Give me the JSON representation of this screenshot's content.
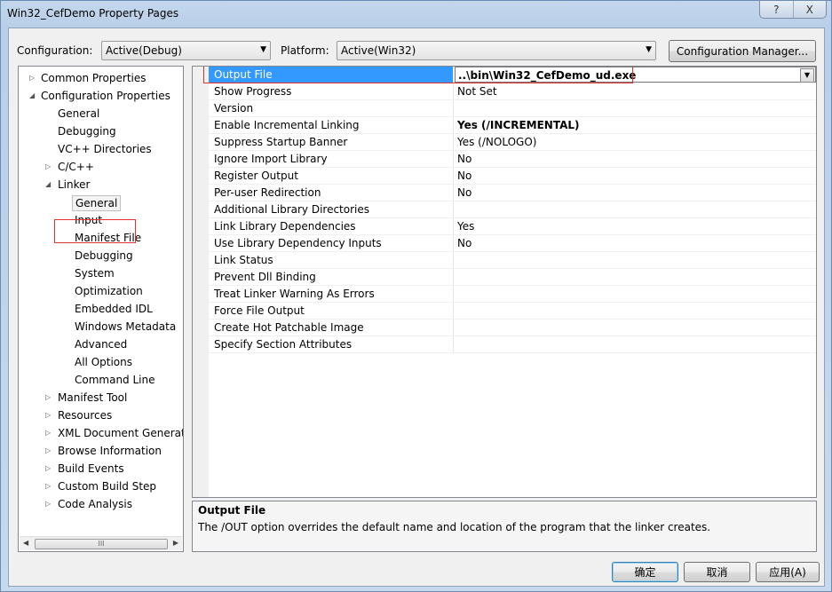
{
  "window": {
    "title": "Win32_CefDemo Property Pages"
  },
  "titlebar_buttons": {
    "help": "?",
    "close": "X"
  },
  "config": {
    "config_label": "Configuration:",
    "config_value": "Active(Debug)",
    "platform_label": "Platform:",
    "platform_value": "Active(Win32)",
    "manager_button": "Configuration Manager..."
  },
  "tree": {
    "items": [
      {
        "label": "Common Properties",
        "expander": "collapsed"
      },
      {
        "label": "Configuration Properties",
        "expander": "expanded"
      },
      {
        "label": "General",
        "expander": "none"
      },
      {
        "label": "Debugging",
        "expander": "none"
      },
      {
        "label": "VC++ Directories",
        "expander": "none"
      },
      {
        "label": "C/C++",
        "expander": "collapsed"
      },
      {
        "label": "Linker",
        "expander": "expanded"
      },
      {
        "label": "General",
        "expander": "none",
        "selected": true
      },
      {
        "label": "Input",
        "expander": "none"
      },
      {
        "label": "Manifest File",
        "expander": "none"
      },
      {
        "label": "Debugging",
        "expander": "none"
      },
      {
        "label": "System",
        "expander": "none"
      },
      {
        "label": "Optimization",
        "expander": "none"
      },
      {
        "label": "Embedded IDL",
        "expander": "none"
      },
      {
        "label": "Windows Metadata",
        "expander": "none"
      },
      {
        "label": "Advanced",
        "expander": "none"
      },
      {
        "label": "All Options",
        "expander": "none"
      },
      {
        "label": "Command Line",
        "expander": "none"
      },
      {
        "label": "Manifest Tool",
        "expander": "collapsed"
      },
      {
        "label": "Resources",
        "expander": "collapsed"
      },
      {
        "label": "XML Document Generat",
        "expander": "collapsed"
      },
      {
        "label": "Browse Information",
        "expander": "collapsed"
      },
      {
        "label": "Build Events",
        "expander": "collapsed"
      },
      {
        "label": "Custom Build Step",
        "expander": "collapsed"
      },
      {
        "label": "Code Analysis",
        "expander": "collapsed"
      }
    ],
    "scroll_thumb": "III"
  },
  "properties": {
    "rows": [
      {
        "name": "Output File",
        "value": "..\\bin\\Win32_CefDemo_ud.exe",
        "selected": true,
        "bold": true
      },
      {
        "name": "Show Progress",
        "value": "Not Set"
      },
      {
        "name": "Version",
        "value": ""
      },
      {
        "name": "Enable Incremental Linking",
        "value": "Yes (/INCREMENTAL)",
        "bold": true
      },
      {
        "name": "Suppress Startup Banner",
        "value": "Yes (/NOLOGO)"
      },
      {
        "name": "Ignore Import Library",
        "value": "No"
      },
      {
        "name": "Register Output",
        "value": "No"
      },
      {
        "name": "Per-user Redirection",
        "value": "No"
      },
      {
        "name": "Additional Library Directories",
        "value": ""
      },
      {
        "name": "Link Library Dependencies",
        "value": "Yes"
      },
      {
        "name": "Use Library Dependency Inputs",
        "value": "No"
      },
      {
        "name": "Link Status",
        "value": ""
      },
      {
        "name": "Prevent Dll Binding",
        "value": ""
      },
      {
        "name": "Treat Linker Warning As Errors",
        "value": ""
      },
      {
        "name": "Force File Output",
        "value": ""
      },
      {
        "name": "Create Hot Patchable Image",
        "value": ""
      },
      {
        "name": "Specify Section Attributes",
        "value": ""
      }
    ]
  },
  "description": {
    "title": "Output File",
    "text": "The /OUT option overrides the default name and location of the program that the linker creates."
  },
  "buttons": {
    "ok": "确定",
    "cancel": "取消",
    "apply": "应用(A)"
  },
  "colors": {
    "selection": "#3399ff",
    "highlight_box": "#e03030"
  }
}
